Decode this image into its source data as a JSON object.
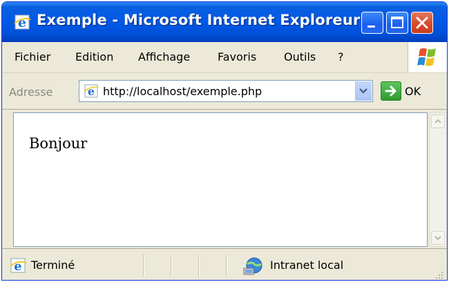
{
  "window": {
    "title": "Exemple - Microsoft Internet Exploreur",
    "controls": {
      "minimize": "minimize",
      "maximize": "maximize",
      "close": "close"
    }
  },
  "menu": {
    "items": [
      "Fichier",
      "Edition",
      "Affichage",
      "Favoris",
      "Outils",
      "?"
    ]
  },
  "address": {
    "label": "Adresse",
    "url": "http://localhost/exemple.php",
    "go_label": "OK"
  },
  "page": {
    "text": "Bonjour"
  },
  "status": {
    "text": "Terminé",
    "zone": "Intranet local"
  },
  "colors": {
    "titlebar": "#0058e6",
    "chrome": "#ece9d8",
    "close_button": "#d4472a",
    "go_button": "#2f9a2f"
  }
}
